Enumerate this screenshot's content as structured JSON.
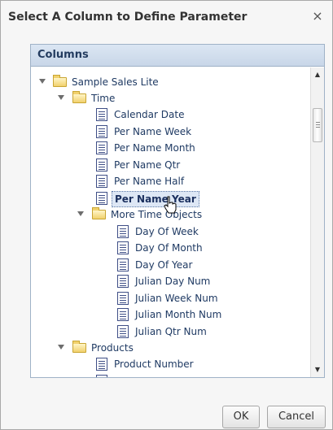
{
  "dialog": {
    "title": "Select A Column to Define Parameter",
    "close_glyph": "×",
    "close_icon": "close-icon"
  },
  "columns_panel": {
    "header": "Columns"
  },
  "tree": {
    "root": "Sample Sales Lite",
    "time_folder": "Time",
    "time_columns": [
      "Calendar Date",
      "Per Name Week",
      "Per Name Month",
      "Per Name Qtr",
      "Per Name Half",
      "Per Name Year"
    ],
    "more_folder": "More Time Objects",
    "more_columns": [
      "Day Of Week",
      "Day Of Month",
      "Day Of Year",
      "Julian Day Num",
      "Julian Week Num",
      "Julian Month Num",
      "Julian Qtr Num"
    ],
    "products_folder": "Products",
    "products_columns": [
      "Product Number"
    ],
    "selected": "Per Name Year"
  },
  "buttons": {
    "ok": "OK",
    "cancel": "Cancel"
  },
  "colors": {
    "header_text": "#233b5f",
    "tree_text": "#1f3a63",
    "folder": "#f1d16d"
  }
}
